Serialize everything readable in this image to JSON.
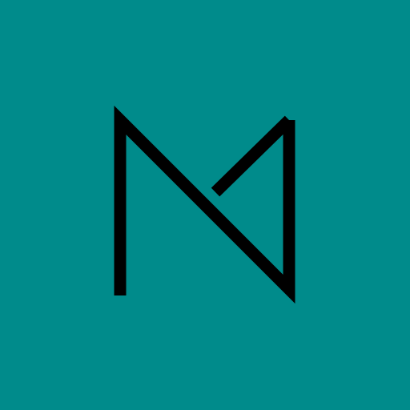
{
  "background": {
    "color": "#008B8B"
  },
  "logo": {
    "name": "monogram-m-icon",
    "stroke_color": "#000000"
  }
}
